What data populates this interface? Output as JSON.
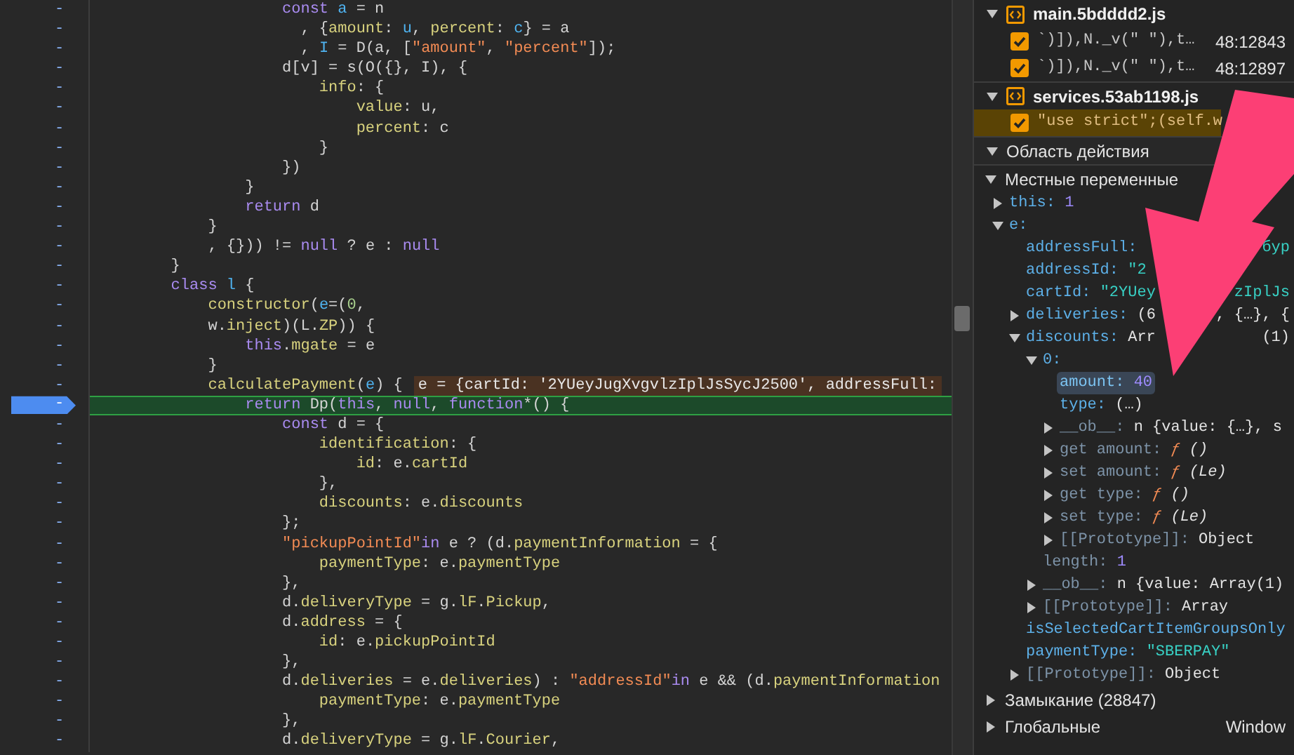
{
  "code_lines": [
    {
      "gutter": "-",
      "paused": false,
      "tokens": [
        {
          "text": "                    const",
          "kind": "keyword"
        },
        {
          "text": " a",
          "kind": "variable"
        },
        {
          "text": " = n",
          "kind": "plain"
        }
      ]
    },
    {
      "gutter": "-",
      "paused": false,
      "tokens": [
        {
          "text": "                      , {",
          "kind": "plain"
        },
        {
          "text": "amount",
          "kind": "property"
        },
        {
          "text": ": ",
          "kind": "plain"
        },
        {
          "text": "u",
          "kind": "variable"
        },
        {
          "text": ", ",
          "kind": "plain"
        },
        {
          "text": "percent",
          "kind": "property"
        },
        {
          "text": ": ",
          "kind": "plain"
        },
        {
          "text": "c",
          "kind": "variable"
        },
        {
          "text": "} = a",
          "kind": "plain"
        }
      ]
    },
    {
      "gutter": "-",
      "paused": false,
      "tokens": [
        {
          "text": "                      , ",
          "kind": "plain"
        },
        {
          "text": "I",
          "kind": "variable"
        },
        {
          "text": " = D(a, [",
          "kind": "plain"
        },
        {
          "text": "\"amount\"",
          "kind": "string"
        },
        {
          "text": ", ",
          "kind": "plain"
        },
        {
          "text": "\"percent\"",
          "kind": "string"
        },
        {
          "text": "]);",
          "kind": "plain"
        }
      ]
    },
    {
      "gutter": "-",
      "paused": false,
      "tokens": [
        {
          "text": "                    d[v] = s(O({}, I), {",
          "kind": "plain"
        }
      ]
    },
    {
      "gutter": "-",
      "paused": false,
      "tokens": [
        {
          "text": "                        info",
          "kind": "property"
        },
        {
          "text": ": {",
          "kind": "plain"
        }
      ]
    },
    {
      "gutter": "-",
      "paused": false,
      "tokens": [
        {
          "text": "                            value",
          "kind": "property"
        },
        {
          "text": ": u,",
          "kind": "plain"
        }
      ]
    },
    {
      "gutter": "-",
      "paused": false,
      "tokens": [
        {
          "text": "                            percent",
          "kind": "property"
        },
        {
          "text": ": c",
          "kind": "plain"
        }
      ]
    },
    {
      "gutter": "-",
      "paused": false,
      "tokens": [
        {
          "text": "                        }",
          "kind": "plain"
        }
      ]
    },
    {
      "gutter": "-",
      "paused": false,
      "tokens": [
        {
          "text": "                    })",
          "kind": "plain"
        }
      ]
    },
    {
      "gutter": "-",
      "paused": false,
      "tokens": [
        {
          "text": "                }",
          "kind": "plain"
        }
      ]
    },
    {
      "gutter": "-",
      "paused": false,
      "tokens": [
        {
          "text": "                return",
          "kind": "keyword"
        },
        {
          "text": " d",
          "kind": "plain"
        }
      ]
    },
    {
      "gutter": "-",
      "paused": false,
      "tokens": [
        {
          "text": "            }",
          "kind": "plain"
        }
      ]
    },
    {
      "gutter": "-",
      "paused": false,
      "tokens": [
        {
          "text": "            , {})) != ",
          "kind": "plain"
        },
        {
          "text": "null",
          "kind": "keyword"
        },
        {
          "text": " ? e : ",
          "kind": "plain"
        },
        {
          "text": "null",
          "kind": "keyword"
        }
      ]
    },
    {
      "gutter": "-",
      "paused": false,
      "tokens": [
        {
          "text": "        }",
          "kind": "plain"
        }
      ]
    },
    {
      "gutter": "-",
      "paused": false,
      "tokens": [
        {
          "text": "        class",
          "kind": "keyword"
        },
        {
          "text": " l",
          "kind": "variable"
        },
        {
          "text": " {",
          "kind": "plain"
        }
      ]
    },
    {
      "gutter": "-",
      "paused": false,
      "tokens": [
        {
          "text": "            constructor",
          "kind": "property"
        },
        {
          "text": "(",
          "kind": "plain"
        },
        {
          "text": "e",
          "kind": "variable"
        },
        {
          "text": "=(",
          "kind": "plain"
        },
        {
          "text": "0",
          "kind": "number"
        },
        {
          "text": ",",
          "kind": "plain"
        }
      ]
    },
    {
      "gutter": "-",
      "paused": false,
      "tokens": [
        {
          "text": "            w.",
          "kind": "plain"
        },
        {
          "text": "inject",
          "kind": "property"
        },
        {
          "text": ")(L.",
          "kind": "plain"
        },
        {
          "text": "ZP",
          "kind": "property"
        },
        {
          "text": ")) {",
          "kind": "plain"
        }
      ]
    },
    {
      "gutter": "-",
      "paused": false,
      "tokens": [
        {
          "text": "                this",
          "kind": "keyword"
        },
        {
          "text": ".",
          "kind": "plain"
        },
        {
          "text": "mgate",
          "kind": "property"
        },
        {
          "text": " = e",
          "kind": "plain"
        }
      ]
    },
    {
      "gutter": "-",
      "paused": false,
      "tokens": [
        {
          "text": "            }",
          "kind": "plain"
        }
      ]
    },
    {
      "gutter": "-",
      "paused": false,
      "tokens": [
        {
          "text": "            calculatePayment",
          "kind": "property"
        },
        {
          "text": "(",
          "kind": "plain"
        },
        {
          "text": "e",
          "kind": "variable"
        },
        {
          "text": ") {",
          "kind": "plain"
        }
      ],
      "inline_value": "e = {cartId: '2YUeyJugXvgvlzIplJsSycJ2500', addressFull:"
    },
    {
      "gutter": "-",
      "paused": true,
      "tokens": [
        {
          "text": "                return",
          "kind": "keyword"
        },
        {
          "text": " Dp(",
          "kind": "plain"
        },
        {
          "text": "this",
          "kind": "keyword"
        },
        {
          "text": ", ",
          "kind": "plain"
        },
        {
          "text": "null",
          "kind": "keyword"
        },
        {
          "text": ", ",
          "kind": "plain"
        },
        {
          "text": "function",
          "kind": "keyword"
        },
        {
          "text": "*() {",
          "kind": "plain"
        }
      ]
    },
    {
      "gutter": "-",
      "paused": false,
      "tokens": [
        {
          "text": "                    const",
          "kind": "keyword"
        },
        {
          "text": " d = {",
          "kind": "plain"
        }
      ]
    },
    {
      "gutter": "-",
      "paused": false,
      "tokens": [
        {
          "text": "                        identification",
          "kind": "property"
        },
        {
          "text": ": {",
          "kind": "plain"
        }
      ]
    },
    {
      "gutter": "-",
      "paused": false,
      "tokens": [
        {
          "text": "                            id",
          "kind": "property"
        },
        {
          "text": ": e.",
          "kind": "plain"
        },
        {
          "text": "cartId",
          "kind": "property"
        }
      ]
    },
    {
      "gutter": "-",
      "paused": false,
      "tokens": [
        {
          "text": "                        },",
          "kind": "plain"
        }
      ]
    },
    {
      "gutter": "-",
      "paused": false,
      "tokens": [
        {
          "text": "                        discounts",
          "kind": "property"
        },
        {
          "text": ": e.",
          "kind": "plain"
        },
        {
          "text": "discounts",
          "kind": "property"
        }
      ]
    },
    {
      "gutter": "-",
      "paused": false,
      "tokens": [
        {
          "text": "                    };",
          "kind": "plain"
        }
      ]
    },
    {
      "gutter": "-",
      "paused": false,
      "tokens": [
        {
          "text": "                    \"pickupPointId\"",
          "kind": "string"
        },
        {
          "text": "in",
          "kind": "keyword"
        },
        {
          "text": " e ? (d.",
          "kind": "plain"
        },
        {
          "text": "paymentInformation",
          "kind": "property"
        },
        {
          "text": " = {",
          "kind": "plain"
        }
      ]
    },
    {
      "gutter": "-",
      "paused": false,
      "tokens": [
        {
          "text": "                        paymentType",
          "kind": "property"
        },
        {
          "text": ": e.",
          "kind": "plain"
        },
        {
          "text": "paymentType",
          "kind": "property"
        }
      ]
    },
    {
      "gutter": "-",
      "paused": false,
      "tokens": [
        {
          "text": "                    },",
          "kind": "plain"
        }
      ]
    },
    {
      "gutter": "-",
      "paused": false,
      "tokens": [
        {
          "text": "                    d.",
          "kind": "plain"
        },
        {
          "text": "deliveryType",
          "kind": "property"
        },
        {
          "text": " = g.",
          "kind": "plain"
        },
        {
          "text": "lF",
          "kind": "property"
        },
        {
          "text": ".",
          "kind": "plain"
        },
        {
          "text": "Pickup",
          "kind": "property"
        },
        {
          "text": ",",
          "kind": "plain"
        }
      ]
    },
    {
      "gutter": "-",
      "paused": false,
      "tokens": [
        {
          "text": "                    d.",
          "kind": "plain"
        },
        {
          "text": "address",
          "kind": "property"
        },
        {
          "text": " = {",
          "kind": "plain"
        }
      ]
    },
    {
      "gutter": "-",
      "paused": false,
      "tokens": [
        {
          "text": "                        id",
          "kind": "property"
        },
        {
          "text": ": e.",
          "kind": "plain"
        },
        {
          "text": "pickupPointId",
          "kind": "property"
        }
      ]
    },
    {
      "gutter": "-",
      "paused": false,
      "tokens": [
        {
          "text": "                    },",
          "kind": "plain"
        }
      ]
    },
    {
      "gutter": "-",
      "paused": false,
      "tokens": [
        {
          "text": "                    d.",
          "kind": "plain"
        },
        {
          "text": "deliveries",
          "kind": "property"
        },
        {
          "text": " = e.",
          "kind": "plain"
        },
        {
          "text": "deliveries",
          "kind": "property"
        },
        {
          "text": ") : ",
          "kind": "plain"
        },
        {
          "text": "\"addressId\"",
          "kind": "string"
        },
        {
          "text": "in",
          "kind": "keyword"
        },
        {
          "text": " e && (d.",
          "kind": "plain"
        },
        {
          "text": "paymentInformation",
          "kind": "property"
        }
      ]
    },
    {
      "gutter": "-",
      "paused": false,
      "tokens": [
        {
          "text": "                        paymentType",
          "kind": "property"
        },
        {
          "text": ": e.",
          "kind": "plain"
        },
        {
          "text": "paymentType",
          "kind": "property"
        }
      ]
    },
    {
      "gutter": "-",
      "paused": false,
      "tokens": [
        {
          "text": "                    },",
          "kind": "plain"
        }
      ]
    },
    {
      "gutter": "-",
      "paused": false,
      "tokens": [
        {
          "text": "                    d.",
          "kind": "plain"
        },
        {
          "text": "deliveryType",
          "kind": "property"
        },
        {
          "text": " = g.",
          "kind": "plain"
        },
        {
          "text": "lF",
          "kind": "property"
        },
        {
          "text": ".",
          "kind": "plain"
        },
        {
          "text": "Courier",
          "kind": "property"
        },
        {
          "text": ",",
          "kind": "plain"
        }
      ]
    }
  ],
  "breakpoints": [
    {
      "file": "main.5bdddd2.js",
      "expanded": true,
      "items": [
        {
          "code": "`)]),N._v(\" \"),t…",
          "location": "48:12843",
          "checked": true,
          "selected": false
        },
        {
          "code": "`)]),N._v(\" \"),t…",
          "location": "48:12897",
          "checked": true,
          "selected": false
        }
      ]
    },
    {
      "file": "services.53ab1198.js",
      "expanded": true,
      "items": [
        {
          "code": "\"use strict\";(self.w",
          "checked": true,
          "selected": true
        }
      ]
    }
  ],
  "scope": {
    "title": "Область действия",
    "expanded": true,
    "sections": [
      {
        "title": "Местные переменные",
        "expanded": true,
        "children": [
          {
            "key": "this:",
            "value": "1",
            "kind": "number",
            "expanded": false,
            "dim": false,
            "selected": false
          },
          {
            "key": "e:",
            "expanded": true,
            "dim": false,
            "selected": false,
            "children": [
              {
                "key": "addressFull:",
                "value_right": "бур",
                "kind": "string",
                "dim": false,
                "selected": false
              },
              {
                "key": "addressId:",
                "value": "\"2",
                "kind": "string",
                "dim": false,
                "selected": false
              },
              {
                "key": "cartId:",
                "value": "\"2YUey",
                "value_right": "zIplJs",
                "kind": "string",
                "dim": false,
                "selected": false
              },
              {
                "key": "deliveries:",
                "value": "(6",
                "value_right": ", {…}, {",
                "kind": "object",
                "expanded": false,
                "dim": false,
                "selected": false
              },
              {
                "key": "discounts:",
                "value": "Arr",
                "value_right": "(1)",
                "kind": "object",
                "expanded": true,
                "dim": false,
                "selected": false,
                "children": [
                  {
                    "key": "0:",
                    "expanded": true,
                    "dim": false,
                    "selected": false,
                    "children": [
                      {
                        "key": "amount:",
                        "value": "40",
                        "kind": "number",
                        "dim": false,
                        "selected": true
                      },
                      {
                        "key": "type:",
                        "value": "(…)",
                        "kind": "object",
                        "dim": false,
                        "selected": false
                      },
                      {
                        "key": "__ob__:",
                        "value": "n {value: {…}, s",
                        "kind": "object",
                        "expanded": false,
                        "dim": true,
                        "selected": false
                      },
                      {
                        "key": "get amount:",
                        "value": "ƒ ()",
                        "kind": "function",
                        "expanded": false,
                        "dim": true,
                        "selected": false
                      },
                      {
                        "key": "set amount:",
                        "value": "ƒ (Le)",
                        "kind": "function",
                        "expanded": false,
                        "dim": true,
                        "selected": false
                      },
                      {
                        "key": "get type:",
                        "value": "ƒ ()",
                        "kind": "function",
                        "expanded": false,
                        "dim": true,
                        "selected": false
                      },
                      {
                        "key": "set type:",
                        "value": "ƒ (Le)",
                        "kind": "function",
                        "expanded": false,
                        "dim": true,
                        "selected": false
                      },
                      {
                        "key": "[[Prototype]]:",
                        "value": "Object",
                        "kind": "object",
                        "expanded": false,
                        "dim": true,
                        "selected": false
                      }
                    ]
                  },
                  {
                    "key": "length:",
                    "value": "1",
                    "kind": "number",
                    "dim": true,
                    "selected": false
                  },
                  {
                    "key": "__ob__:",
                    "value": "n {value: Array(1)",
                    "kind": "object",
                    "expanded": false,
                    "dim": true,
                    "selected": false
                  },
                  {
                    "key": "[[Prototype]]:",
                    "value": "Array",
                    "kind": "object",
                    "expanded": false,
                    "dim": true,
                    "selected": false
                  }
                ]
              },
              {
                "key": "isSelectedCartItemGroupsOnly",
                "dim": false,
                "selected": false
              },
              {
                "key": "paymentType:",
                "value": "\"SBERPAY\"",
                "kind": "string",
                "dim": false,
                "selected": false
              },
              {
                "key": "[[Prototype]]:",
                "value": "Object",
                "kind": "object",
                "expanded": false,
                "dim": true,
                "selected": false
              }
            ]
          }
        ]
      },
      {
        "title": "Замыкание (28847)",
        "expanded": false
      },
      {
        "title": "Глобальные",
        "value": "Window",
        "expanded": false
      }
    ]
  }
}
